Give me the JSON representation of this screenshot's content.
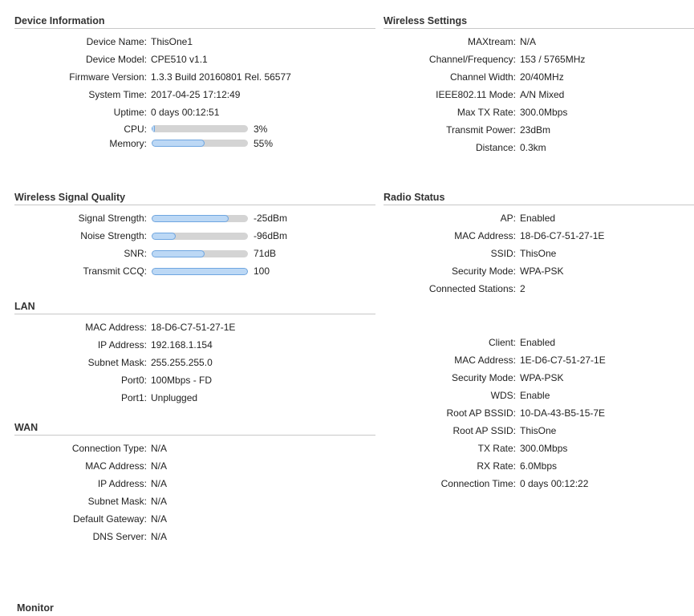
{
  "device_info": {
    "title": "Device Information",
    "rows": [
      {
        "label": "Device Name:",
        "value": "ThisOne1"
      },
      {
        "label": "Device Model:",
        "value": "CPE510 v1.1"
      },
      {
        "label": "Firmware Version:",
        "value": "1.3.3 Build 20160801 Rel. 56577"
      },
      {
        "label": "System Time:",
        "value": "2017-04-25 17:12:49"
      },
      {
        "label": "Uptime:",
        "value": "0 days 00:12:51"
      }
    ],
    "bars": [
      {
        "label": "CPU:",
        "value": "3%",
        "percent": 3
      },
      {
        "label": "Memory:",
        "value": "55%",
        "percent": 55
      }
    ]
  },
  "wireless_settings": {
    "title": "Wireless Settings",
    "rows": [
      {
        "label": "MAXtream:",
        "value": "N/A"
      },
      {
        "label": "Channel/Frequency:",
        "value": "153 / 5765MHz"
      },
      {
        "label": "Channel Width:",
        "value": "20/40MHz"
      },
      {
        "label": "IEEE802.11 Mode:",
        "value": "A/N Mixed"
      },
      {
        "label": "Max TX Rate:",
        "value": "300.0Mbps"
      },
      {
        "label": "Transmit Power:",
        "value": "23dBm"
      },
      {
        "label": "Distance:",
        "value": "0.3km"
      }
    ]
  },
  "signal_quality": {
    "title": "Wireless Signal Quality",
    "bars": [
      {
        "label": "Signal Strength:",
        "value": "-25dBm",
        "percent": 80
      },
      {
        "label": "Noise Strength:",
        "value": "-96dBm",
        "percent": 25
      },
      {
        "label": "SNR:",
        "value": "71dB",
        "percent": 55
      },
      {
        "label": "Transmit CCQ:",
        "value": "100",
        "percent": 100
      }
    ]
  },
  "radio_status": {
    "title": "Radio Status",
    "ap_rows": [
      {
        "label": "AP:",
        "value": "Enabled"
      },
      {
        "label": "MAC Address:",
        "value": "18-D6-C7-51-27-1E"
      },
      {
        "label": "SSID:",
        "value": "ThisOne"
      },
      {
        "label": "Security Mode:",
        "value": "WPA-PSK"
      },
      {
        "label": "Connected Stations:",
        "value": "2"
      }
    ],
    "client_rows": [
      {
        "label": "Client:",
        "value": "Enabled"
      },
      {
        "label": "MAC Address:",
        "value": "1E-D6-C7-51-27-1E"
      },
      {
        "label": "Security Mode:",
        "value": "WPA-PSK"
      },
      {
        "label": "WDS:",
        "value": "Enable"
      },
      {
        "label": "Root AP BSSID:",
        "value": "10-DA-43-B5-15-7E"
      },
      {
        "label": "Root AP SSID:",
        "value": "ThisOne"
      },
      {
        "label": "TX Rate:",
        "value": "300.0Mbps"
      },
      {
        "label": "RX Rate:",
        "value": "6.0Mbps"
      },
      {
        "label": "Connection Time:",
        "value": "0 days 00:12:22"
      }
    ]
  },
  "lan": {
    "title": "LAN",
    "rows": [
      {
        "label": "MAC Address:",
        "value": "18-D6-C7-51-27-1E"
      },
      {
        "label": "IP Address:",
        "value": "192.168.1.154"
      },
      {
        "label": "Subnet Mask:",
        "value": "255.255.255.0"
      },
      {
        "label": "Port0:",
        "value": "100Mbps - FD"
      },
      {
        "label": "Port1:",
        "value": "Unplugged"
      }
    ]
  },
  "wan": {
    "title": "WAN",
    "rows": [
      {
        "label": "Connection Type:",
        "value": "N/A"
      },
      {
        "label": "MAC Address:",
        "value": "N/A"
      },
      {
        "label": "IP Address:",
        "value": "N/A"
      },
      {
        "label": "Subnet Mask:",
        "value": "N/A"
      },
      {
        "label": "Default Gateway:",
        "value": "N/A"
      },
      {
        "label": "DNS Server:",
        "value": "N/A"
      }
    ]
  },
  "monitor": {
    "title": "Monitor"
  }
}
